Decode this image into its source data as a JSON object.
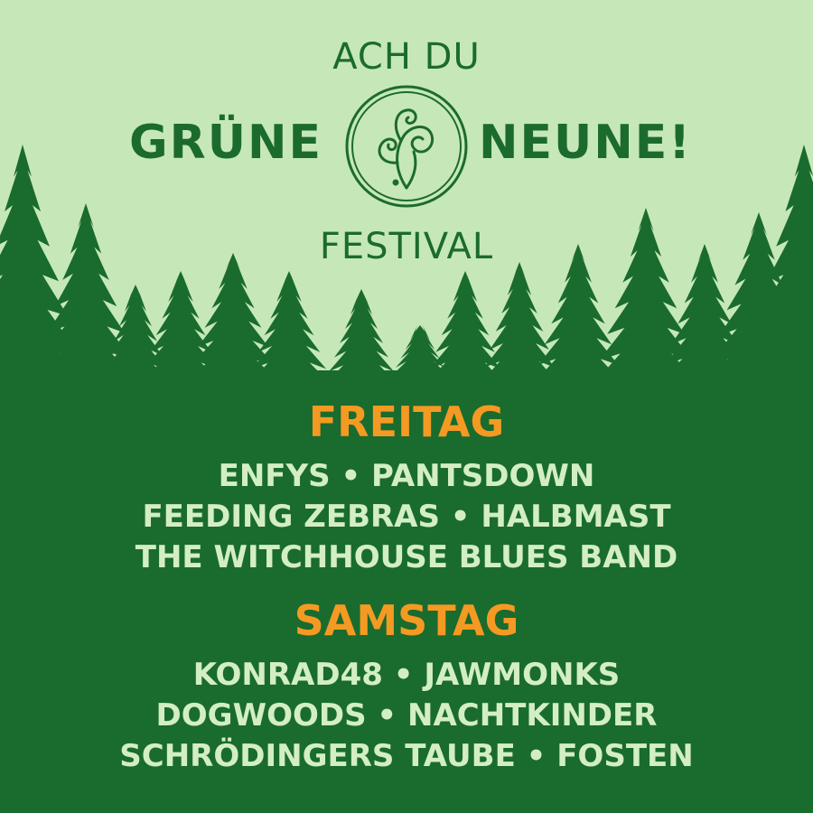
{
  "logo": {
    "top_line": "ACH DU",
    "word_left": "GRÜNE",
    "word_right": "NEUNE!",
    "bottom_line": "FESTIVAL",
    "emblem_icon": "fern-fiddlehead-emblem"
  },
  "colors": {
    "sky": "#c6e8b9",
    "forest": "#1a6b2e",
    "logo_text": "#1c6b2e",
    "day_heading": "#f49a23",
    "band_text": "#d3eec5"
  },
  "lineup": [
    {
      "day": "FREITAG",
      "lines": [
        "ENFYS • PANTSDOWN",
        "FEEDING ZEBRAS • HALBMAST",
        "THE WITCHHOUSE BLUES BAND"
      ]
    },
    {
      "day": "SAMSTAG",
      "lines": [
        "KONRAD48 • JAWMONKS",
        "DOGWOODS • NACHTKINDER",
        "SCHRÖDINGERS TAUBE • FOSTEN"
      ]
    }
  ]
}
